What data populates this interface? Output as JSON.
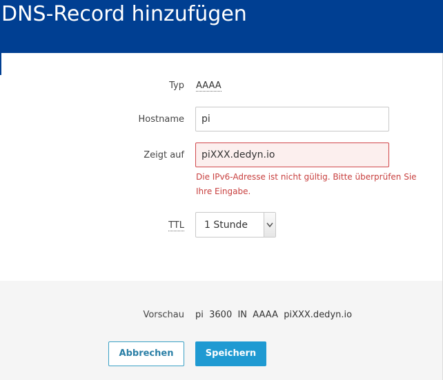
{
  "dialog": {
    "title": "DNS-Record hinzufügen"
  },
  "form": {
    "type_label": "Typ",
    "type_value": "AAAA",
    "hostname_label": "Hostname",
    "hostname_value": "pi",
    "target_label": "Zeigt auf",
    "target_value": "piXXX.dedyn.io",
    "target_error": "Die IPv6-Adresse ist nicht gültig. Bitte überprüfen Sie Ihre Eingabe.",
    "ttl_label": "TTL",
    "ttl_value": "1 Stunde"
  },
  "preview": {
    "label": "Vorschau",
    "text": "pi  3600  IN  AAAA  piXXX.dedyn.io"
  },
  "buttons": {
    "cancel_label": "Abbrechen",
    "save_label": "Speichern"
  },
  "colors": {
    "header": "#003f92",
    "error": "#c8403f",
    "primary": "#1f9ad2"
  }
}
